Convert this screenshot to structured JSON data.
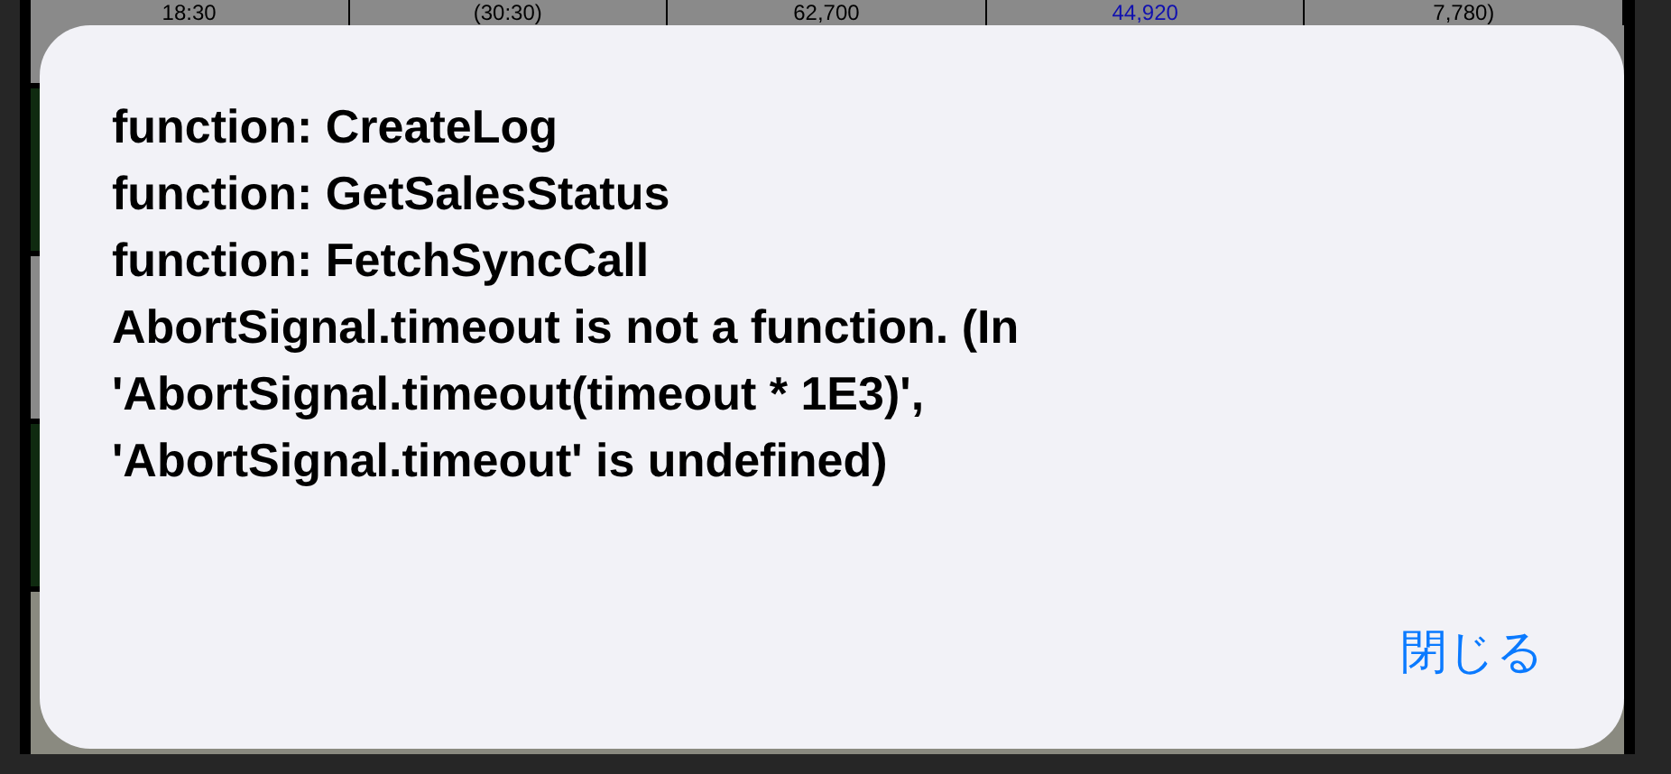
{
  "background_table": {
    "row_cells": [
      {
        "text": "18:30",
        "kind": "plain"
      },
      {
        "text": "(30:30)",
        "kind": "plain"
      },
      {
        "text": "62,700",
        "kind": "plain"
      },
      {
        "text": "44,920",
        "kind": "link"
      },
      {
        "text": "7,780)",
        "kind": "plain"
      }
    ]
  },
  "alert": {
    "message_lines": [
      "function: CreateLog",
      "function: GetSalesStatus",
      "function: FetchSyncCall",
      "AbortSignal.timeout is not a function. (In 'AbortSignal.timeout(timeout * 1E3)', 'AbortSignal.timeout' is undefined)"
    ],
    "button": "閉じる"
  }
}
